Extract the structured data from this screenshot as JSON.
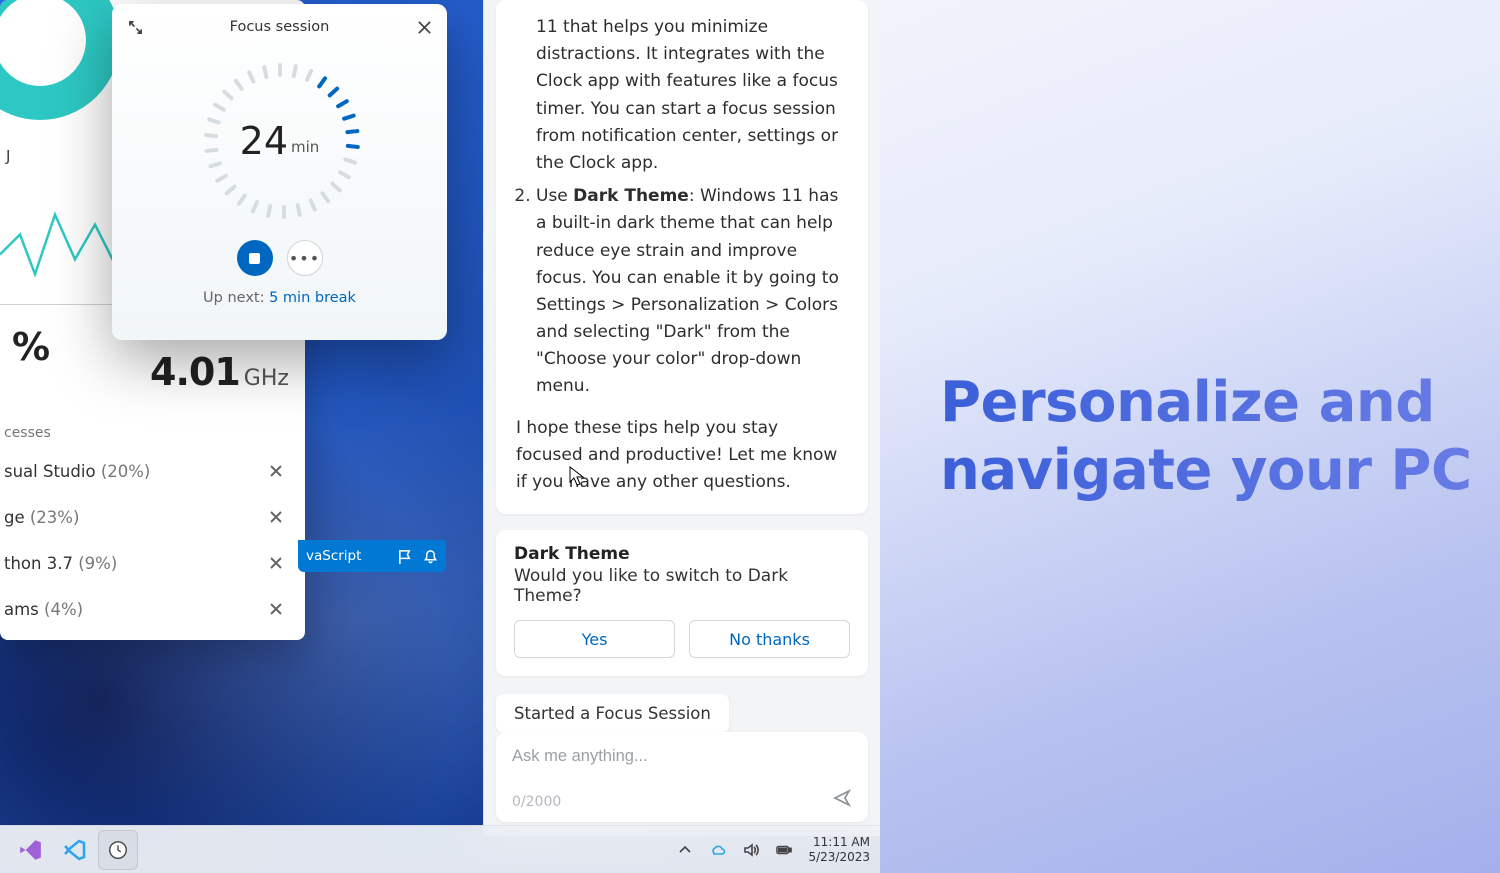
{
  "focus": {
    "title": "Focus session",
    "minutes": "24",
    "unit": "min",
    "upnext_label": "Up next: ",
    "upnext_value": "5 min break"
  },
  "perf": {
    "cpu_label": "J",
    "percent": "%",
    "freq": "4.01",
    "freq_unit": "GHz",
    "processes_label": "cesses",
    "items": [
      {
        "name": "sual Studio",
        "pct": "(20%)"
      },
      {
        "name": "ge",
        "pct": "(23%)"
      },
      {
        "name": "thon 3.7",
        "pct": "(9%)"
      },
      {
        "name": "ams",
        "pct": "(4%)"
      }
    ]
  },
  "vscode_fragment": "vaScript",
  "copilot": {
    "msg_li1_fragment": "11 that helps you minimize distractions. It integrates with the Clock app with features like a focus timer. You can start a focus session from notification center, settings or the Clock app.",
    "msg_li2_pre": "Use ",
    "msg_li2_bold": "Dark Theme",
    "msg_li2_post": ": Windows 11 has a built-in dark theme that can help reduce eye strain and improve focus. You can enable it by going to Settings > Personalization > Colors and selecting \"Dark\" from the \"Choose your color\" drop-down menu.",
    "msg_outro": "I hope these tips help you stay focused and productive! Let me know if you have any other questions.",
    "action_title": "Dark Theme",
    "action_question": "Would you like to switch to Dark Theme?",
    "yes": "Yes",
    "no": "No thanks",
    "chip": "Started a Focus Session",
    "placeholder": "Ask me anything...",
    "counter": "0/2000"
  },
  "taskbar": {
    "time": "11:11 AM",
    "date": "5/23/2023"
  },
  "marketing": {
    "headline": "Personalize and navigate your PC"
  },
  "colors": {
    "accent": "#0067c0"
  }
}
